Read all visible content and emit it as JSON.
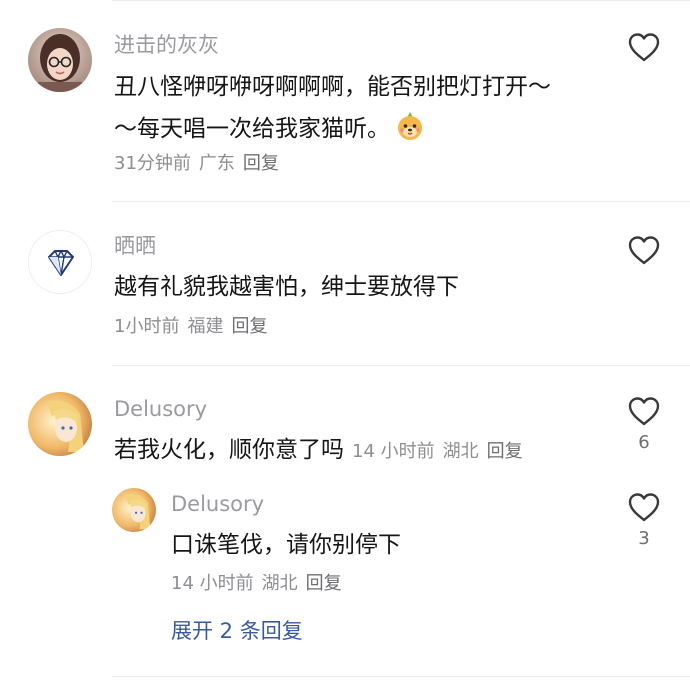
{
  "comments": [
    {
      "username": "进击的灰灰",
      "content_lines": [
        "丑八怪咿呀咿呀啊啊啊，能否别把灯打开～",
        "～每天唱一次给我家猫听。"
      ],
      "time": "31分钟前",
      "location": "广东",
      "reply_label": "回复",
      "like_count": "",
      "emoji": "dog-face-emoji"
    },
    {
      "username": "晒晒",
      "content": "越有礼貌我越害怕，绅士要放得下",
      "time": "1小时前",
      "location": "福建",
      "reply_label": "回复",
      "like_count": "",
      "avatar_icon": "diamond-icon"
    },
    {
      "username": "Delusory",
      "content": "若我火化，顺你意了吗",
      "time": "14 小时前",
      "location": "湖北",
      "reply_label": "回复",
      "like_count": "6",
      "reply": {
        "username": "Delusory",
        "content": "口诛笔伐，请你别停下",
        "time": "14 小时前",
        "location": "湖北",
        "reply_label": "回复",
        "like_count": "3"
      },
      "expand_label": "展开 2 条回复"
    }
  ],
  "colors": {
    "username": "#9a9aa0",
    "text": "#161616",
    "meta": "#8e8e93",
    "link": "#3b5a9a",
    "divider": "#ececec"
  }
}
